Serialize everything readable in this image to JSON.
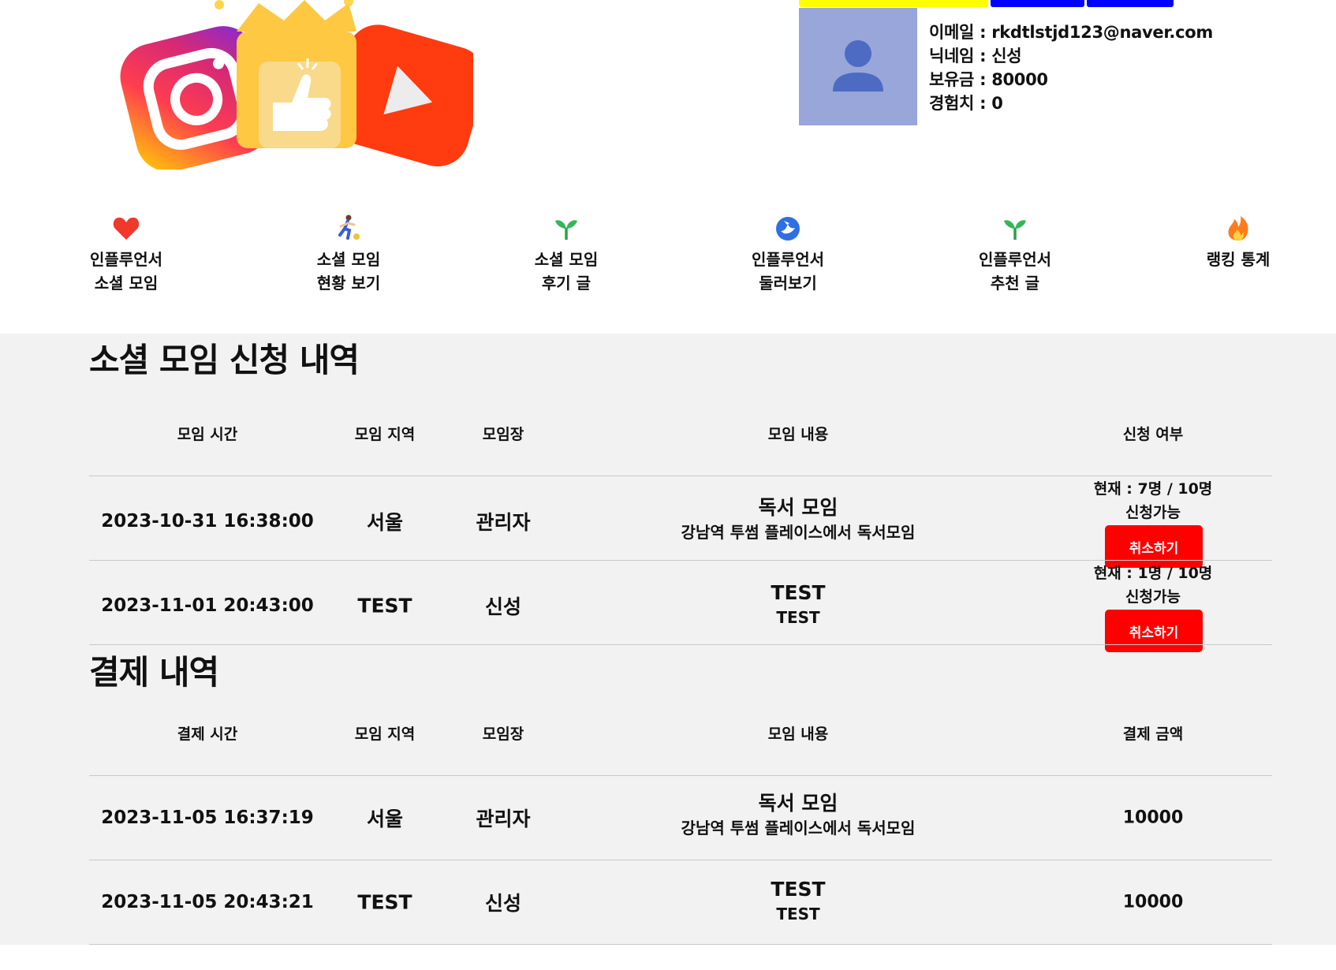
{
  "header": {
    "top_buttons": [
      "#ffff00",
      "#0000ff",
      "#0000ff"
    ]
  },
  "profile": {
    "email_label": "이메일 : ",
    "email": "rkdtlstjd123@naver.com",
    "nickname_label": "닉네임 : ",
    "nickname": "신성",
    "balance_label": "보유금 : ",
    "balance": "80000",
    "exp_label": "경험치 : ",
    "exp": "0"
  },
  "nav": [
    {
      "label": "인플루언서\n소셜 모임",
      "icon": "heart-icon"
    },
    {
      "label": "소셜 모임\n현황 보기",
      "icon": "runner-icon"
    },
    {
      "label": "소셜 모임\n후기 글",
      "icon": "sprout-icon"
    },
    {
      "label": "인플루언서\n둘러보기",
      "icon": "bird-icon"
    },
    {
      "label": "인플루언서\n추천 글",
      "icon": "sprout-icon"
    },
    {
      "label": "랭킹 통계",
      "icon": "fire-icon"
    }
  ],
  "applications": {
    "title": "소셜 모임 신청 내역",
    "headers": [
      "모임 시간",
      "모임 지역",
      "모임장",
      "모임 내용",
      "신청 여부"
    ],
    "rows": [
      {
        "time": "2023-10-31 16:38:00",
        "region": "서울",
        "leader": "관리자",
        "meet_title": "독서 모임",
        "meet_desc": "강남역 투썸 플레이스에서 독서모임",
        "count": "현재 : 7명 / 10명",
        "status": "신청가능",
        "button": "취소하기"
      },
      {
        "time": "2023-11-01 20:43:00",
        "region": "TEST",
        "leader": "신성",
        "meet_title": "TEST",
        "meet_desc": "TEST",
        "count": "현재 : 1명 / 10명",
        "status": "신청가능",
        "button": "취소하기"
      }
    ]
  },
  "payments": {
    "title": "결제 내역",
    "headers": [
      "결제 시간",
      "모임 지역",
      "모임장",
      "모임 내용",
      "결제 금액"
    ],
    "rows": [
      {
        "time": "2023-11-05 16:37:19",
        "region": "서울",
        "leader": "관리자",
        "meet_title": "독서 모임",
        "meet_desc": "강남역 투썸 플레이스에서 독서모임",
        "amount": "10000"
      },
      {
        "time": "2023-11-05 20:43:21",
        "region": "TEST",
        "leader": "신성",
        "meet_title": "TEST",
        "meet_desc": "TEST",
        "amount": "10000"
      }
    ]
  }
}
